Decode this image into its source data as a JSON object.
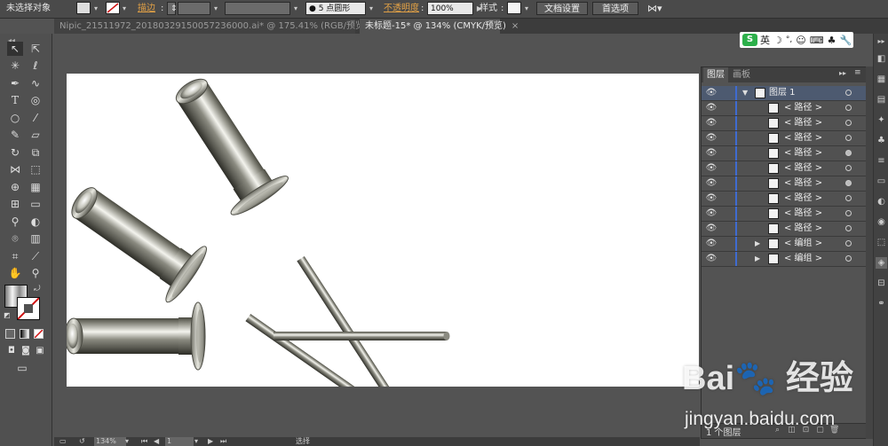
{
  "control_bar": {
    "selection_status": "未选择对象",
    "stroke_label": "描边",
    "brush_value": "5 点圆形",
    "opacity_label": "不透明度",
    "opacity_value": "100%",
    "style_label": "样式",
    "doc_setup_button": "文档设置",
    "preferences_button": "首选项"
  },
  "document_tabs": [
    {
      "label": "Nipic_21511972_20180329150057236000.ai* @ 175.41% (RGB/预览)",
      "active": false
    },
    {
      "label": "未标题-15* @ 134% (CMYK/预览)",
      "active": true
    }
  ],
  "ime_bar": {
    "logo": "S",
    "mode": "英"
  },
  "layers_panel": {
    "tabs": [
      "图层",
      "画板"
    ],
    "rows": [
      {
        "name": "图层 1",
        "kind": "layer",
        "expand": "▼",
        "target_filled": false
      },
      {
        "name": "< 路径 >",
        "kind": "item",
        "expand": "",
        "target_filled": false
      },
      {
        "name": "< 路径 >",
        "kind": "item",
        "expand": "",
        "target_filled": false
      },
      {
        "name": "< 路径 >",
        "kind": "item",
        "expand": "",
        "target_filled": false
      },
      {
        "name": "< 路径 >",
        "kind": "item",
        "expand": "",
        "target_filled": true
      },
      {
        "name": "< 路径 >",
        "kind": "item",
        "expand": "",
        "target_filled": false
      },
      {
        "name": "< 路径 >",
        "kind": "item",
        "expand": "",
        "target_filled": true
      },
      {
        "name": "< 路径 >",
        "kind": "item",
        "expand": "",
        "target_filled": false
      },
      {
        "name": "< 路径 >",
        "kind": "item",
        "expand": "",
        "target_filled": false
      },
      {
        "name": "< 路径 >",
        "kind": "item",
        "expand": "",
        "target_filled": false
      },
      {
        "name": "< 编组 >",
        "kind": "item",
        "expand": "▶",
        "target_filled": false
      },
      {
        "name": "< 编组 >",
        "kind": "item",
        "expand": "▶",
        "target_filled": false
      }
    ],
    "footer_count": "1 个图层"
  },
  "status_bar": {
    "zoom": "134%",
    "page": "1",
    "tool_status": "选择"
  },
  "watermark": {
    "brand": "Bai🐾 经验",
    "url": "jingyan.baidu.com"
  },
  "colors": {
    "accent_orange": "#e0a046",
    "layer_highlight": "#4d5a70",
    "layer_color_bar": "#3f6bd0"
  }
}
